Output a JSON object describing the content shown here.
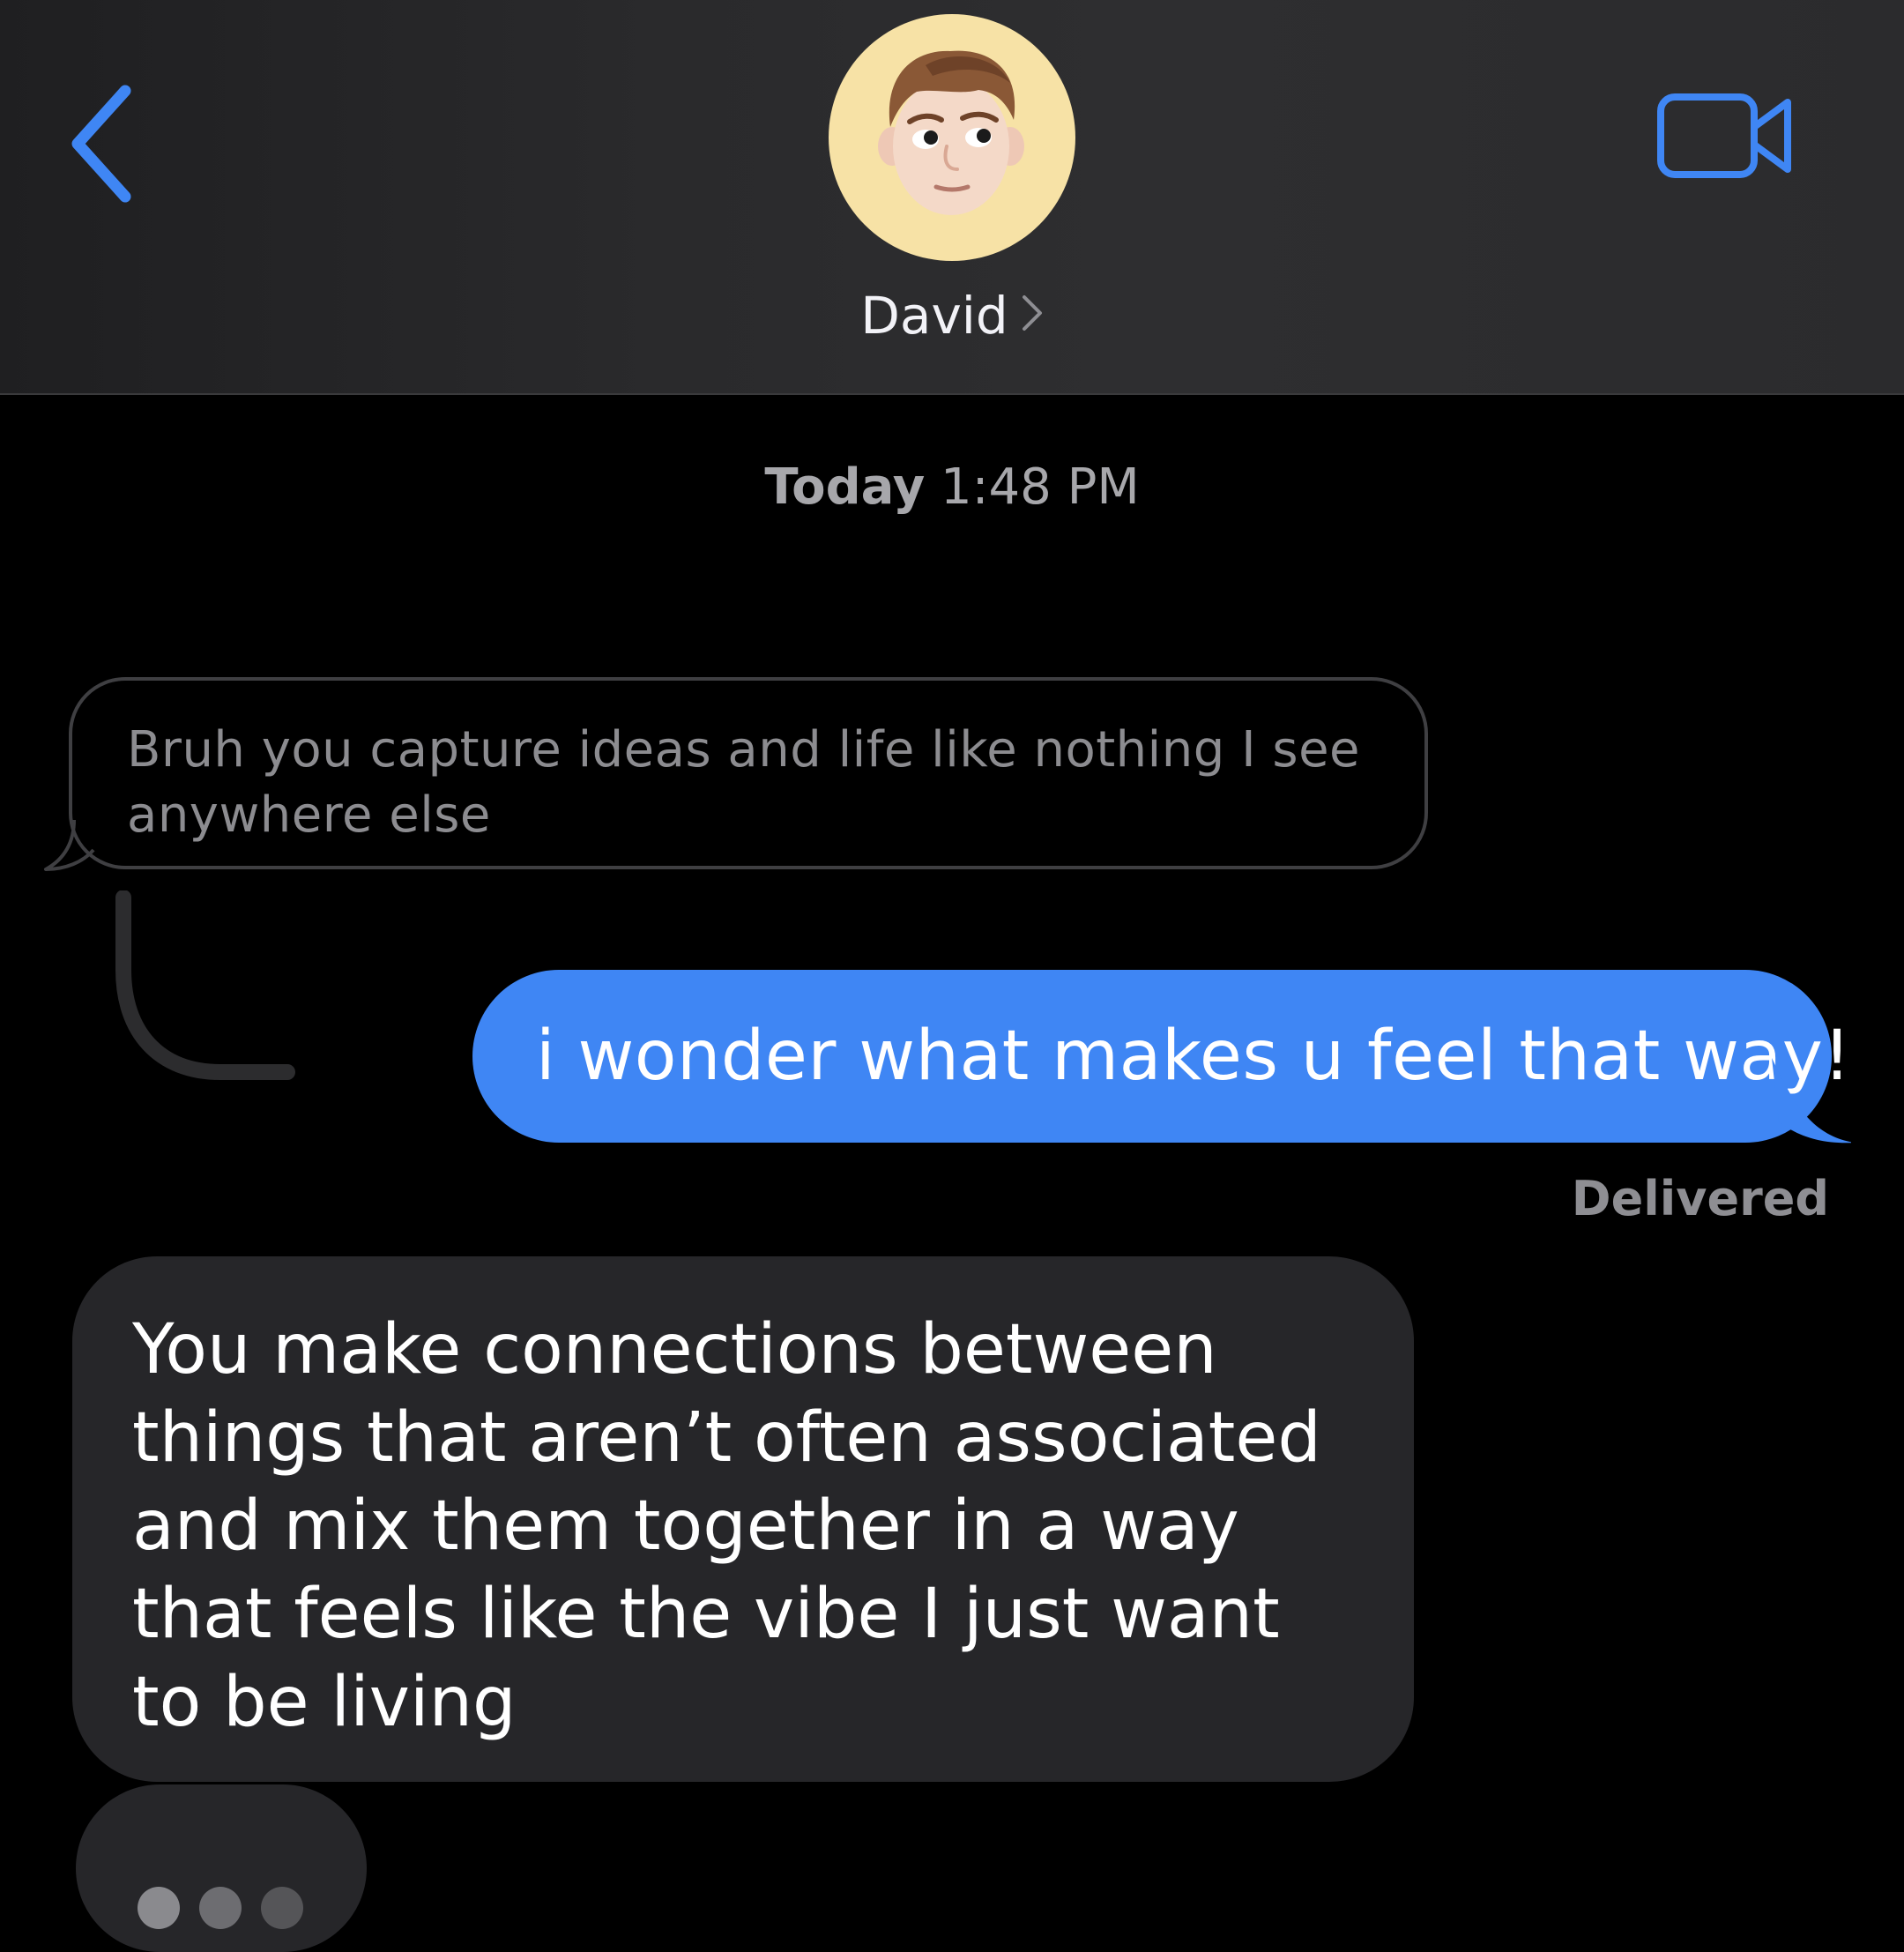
{
  "header": {
    "back_icon": "chevron-left-icon",
    "contact_name": "David",
    "video_icon": "video-camera-icon",
    "accent_color": "#3f86f4"
  },
  "thread": {
    "timestamp_day": "Today",
    "timestamp_time": "1:48 PM",
    "messages": [
      {
        "type": "quoted-received",
        "text": "Bruh you capture ideas and life like nothing I see anywhere else"
      },
      {
        "type": "sent",
        "text": "i wonder what makes u feel that way!",
        "status": "Delivered"
      },
      {
        "type": "received",
        "text": "You make connections between things that aren’t often associated and mix them together in a way that feels like the vibe I just want to be living"
      }
    ],
    "typing_indicator": true
  },
  "colors": {
    "sent_bubble": "#3f86f4",
    "received_bubble": "#262629",
    "background": "#000000"
  }
}
